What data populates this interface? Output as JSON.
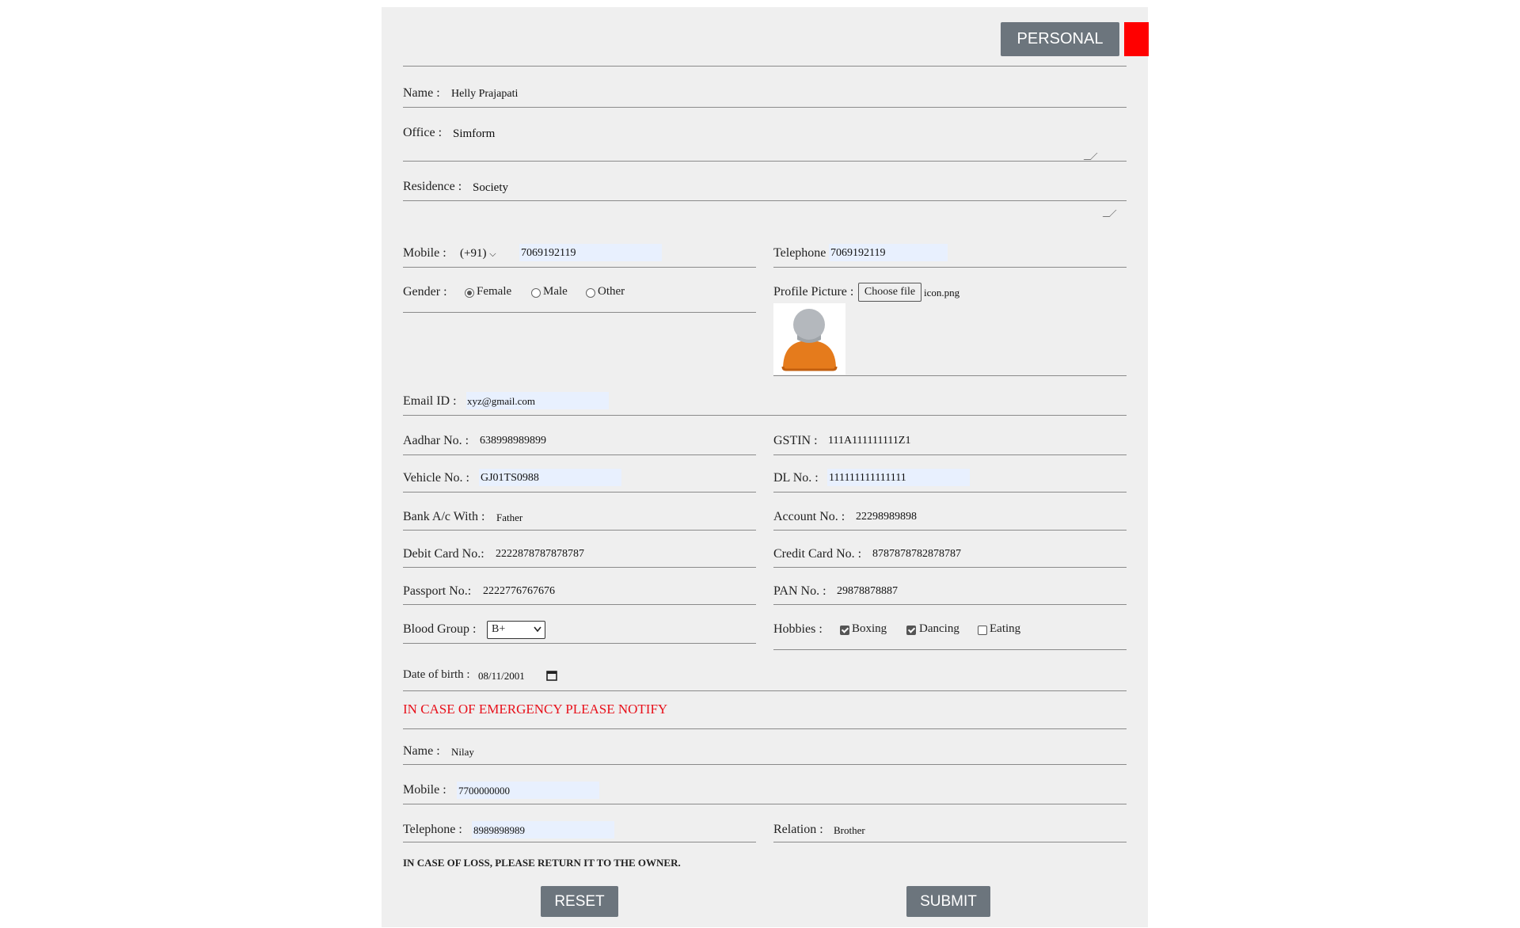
{
  "header": {
    "tab_label": "PERSONAL",
    "accent_color": "#ff0000"
  },
  "form": {
    "name": {
      "label": "Name :",
      "value": "Helly  Prajapati"
    },
    "office": {
      "label": "Office :",
      "value": "Simform"
    },
    "residence": {
      "label": "Residence :",
      "value": "Society"
    },
    "mobile": {
      "label": "Mobile :",
      "code": "(+91)",
      "value": "7069192119"
    },
    "telephone": {
      "label": "Telephone :",
      "value": "7069192119"
    },
    "gender": {
      "label": "Gender :",
      "options": [
        "Female",
        "Male",
        "Other"
      ],
      "selected": "Female"
    },
    "profile_picture": {
      "label": "Profile Picture :",
      "button": "Choose file",
      "file_name": "icon.png"
    },
    "email": {
      "label": "Email ID :",
      "value": "xyz@gmail.com"
    },
    "aadhar": {
      "label": "Aadhar No. :",
      "value": "638998989899"
    },
    "gstin": {
      "label": "GSTIN :",
      "value": "111A111111111Z1"
    },
    "vehicle": {
      "label": "Vehicle No. :",
      "value": "GJ01TS0988"
    },
    "dl": {
      "label": "DL No. :",
      "value": "111111111111111"
    },
    "bank": {
      "label": "Bank A/c With :",
      "value": "Father"
    },
    "account": {
      "label": "Account No. :",
      "value": "22298989898"
    },
    "debit": {
      "label": "Debit Card No.:",
      "value": "2222878787878787"
    },
    "credit": {
      "label": "Credit Card No. :",
      "value": "8787878782878787"
    },
    "passport": {
      "label": "Passport No.:",
      "value": "2222776767676"
    },
    "pan": {
      "label": "PAN No. :",
      "value": "29878878887"
    },
    "blood_group": {
      "label": "Blood Group :",
      "value": "B+"
    },
    "hobbies": {
      "label": "Hobbies :",
      "options": [
        {
          "label": "Boxing",
          "checked": true
        },
        {
          "label": "Dancing",
          "checked": true
        },
        {
          "label": "Eating",
          "checked": false
        }
      ]
    },
    "dob": {
      "label": "Date of birth :",
      "value": "08/11/2001"
    }
  },
  "emergency": {
    "heading": "IN CASE OF EMERGENCY PLEASE NOTIFY",
    "heading_color": "#e8101a",
    "name": {
      "label": "Name :",
      "value": "Nilay"
    },
    "mobile": {
      "label": "Mobile :",
      "value": "7700000000"
    },
    "telephone": {
      "label": "Telephone :",
      "value": "8989898989"
    },
    "relation": {
      "label": "Relation :",
      "value": "Brother"
    }
  },
  "footer": {
    "notice": "IN CASE OF LOSS, PLEASE RETURN IT TO THE OWNER.",
    "reset_label": "RESET",
    "submit_label": "SUBMIT"
  }
}
